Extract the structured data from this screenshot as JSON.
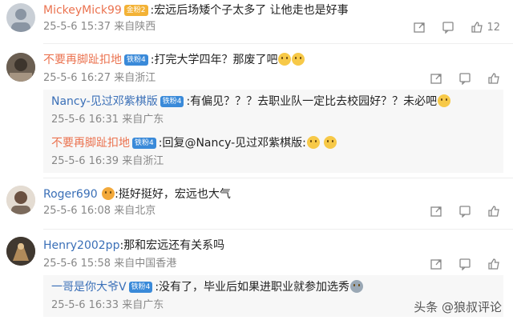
{
  "comments": [
    {
      "user": "MickeyMick99",
      "badge": "金粉2",
      "text": ":宏远后场矮个子太多了  让他走也是好事",
      "time": "25-5-6 15:37",
      "location": "来自陕西",
      "likes": "12"
    },
    {
      "user": "不要再脚趾扣地",
      "badge": "铁粉4",
      "text": ":打完大学四年？那废了吧",
      "time": "25-5-6 16:27",
      "location": "来自浙江",
      "replies": [
        {
          "user": "Nancy-见过邓紫棋版",
          "badge": "铁粉4",
          "text": ":有偏见？？？去职业队一定比去校园好？？未必吧",
          "time": "25-5-6 16:31",
          "location": "来自广东"
        },
        {
          "user": "不要再脚趾扣地",
          "badge": "铁粉4",
          "text": ":回复@Nancy-见过邓紫棋版:",
          "time": "25-5-6 16:39",
          "location": "来自浙江"
        }
      ]
    },
    {
      "user": "Roger690",
      "text": ":挺好挺好，宏远也大气",
      "time": "25-5-6 16:08",
      "location": "来自北京"
    },
    {
      "user": "Henry2002pp",
      "text": ":那和宏远还有关系吗",
      "time": "25-5-6 15:58",
      "location": "来自中国香港",
      "replies": [
        {
          "user": "一哥是你大爷V",
          "badge": "铁粉4",
          "text": ":没有了，毕业后如果进职业就参加选秀",
          "time": "25-5-6 16:33",
          "location": "来自广东"
        }
      ]
    }
  ],
  "watermark": "头条 @狼叔评论",
  "icons": [
    "share-icon",
    "comment-icon",
    "like-icon"
  ]
}
